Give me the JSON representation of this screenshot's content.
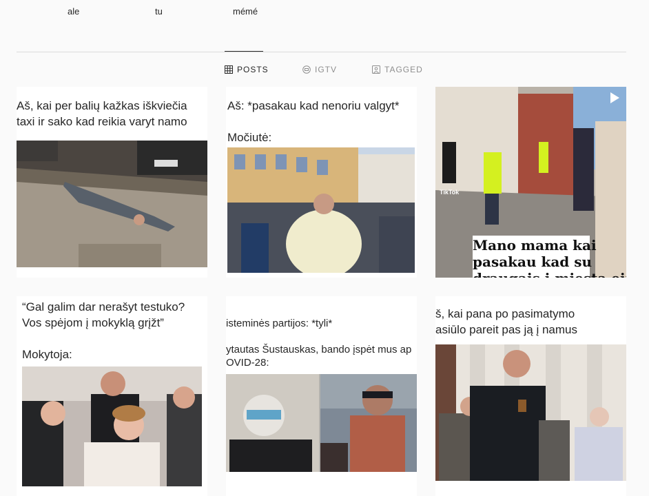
{
  "profile_names": [
    "ale",
    "tu",
    "mémé"
  ],
  "tabs": [
    {
      "label": "POSTS",
      "icon": "grid-icon",
      "active": true
    },
    {
      "label": "IGTV",
      "icon": "igtv-icon",
      "active": false
    },
    {
      "label": "TAGGED",
      "icon": "tagged-icon",
      "active": false
    }
  ],
  "posts": [
    {
      "caption": "Aš, kai per balių kažkas iškviečia\ntaxi ir sako kad reikia varyt namo"
    },
    {
      "caption": "Aš: *pasakau kad nenoriu valgyt*\n\nMočiutė:"
    },
    {
      "overlay": "Mano mama kai\npasakau kad su\ndraugais į miestą einu",
      "watermark": "TikTok",
      "is_video": true
    },
    {
      "caption": "“Gal galim dar nerašyt testuko?\nVos spėjom į mokyklą grįžt”\n\nMokytoja:"
    },
    {
      "caption": "isteminės partijos: *tyli*\n\nytautas Šustauskas, bando įspėt mus ap\nOVID-28:"
    },
    {
      "caption": "š, kai pana po pasimatymo\nasiūlo pareit pas ją į namus"
    }
  ],
  "colors": {
    "text": "#262626",
    "muted": "#8e8e8e",
    "divider": "#dbdbdb",
    "background": "#fafafa"
  }
}
